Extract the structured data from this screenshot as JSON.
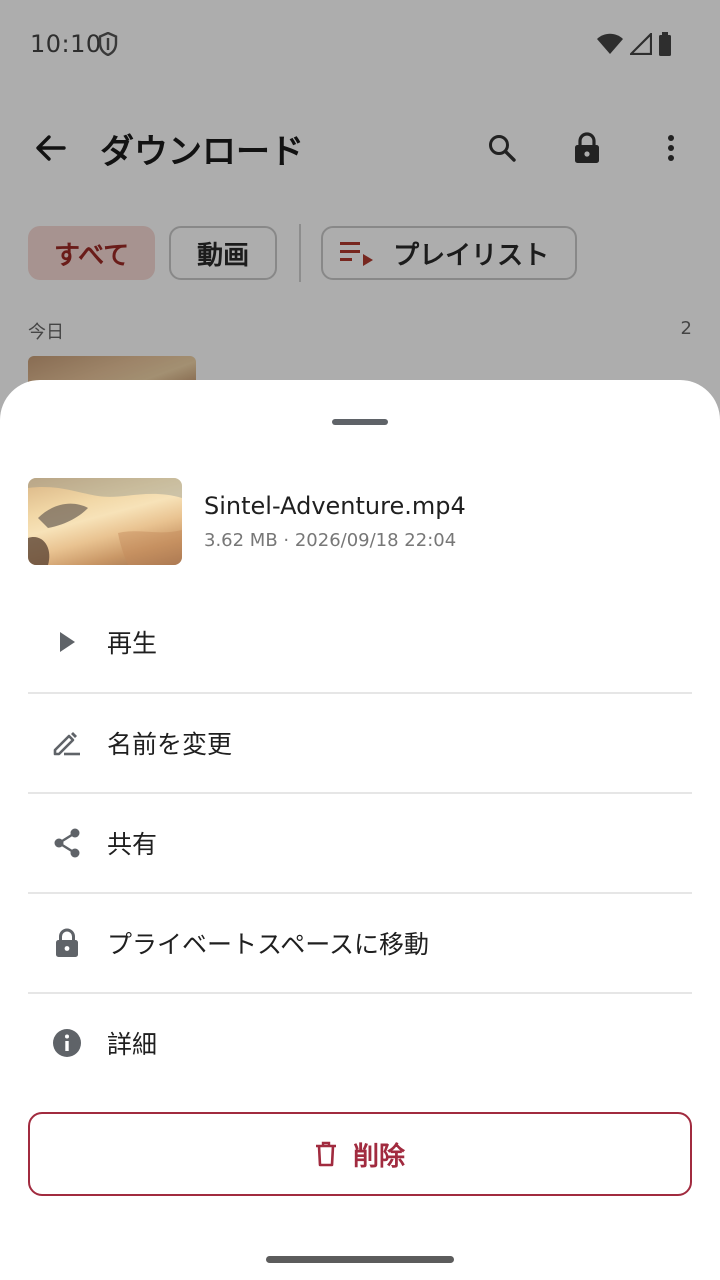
{
  "status_bar": {
    "time": "10:10",
    "icons": [
      "shield-icon",
      "wifi-icon",
      "signal-icon",
      "battery-icon"
    ]
  },
  "toolbar": {
    "title": "ダウンロード",
    "icons": [
      "back-arrow-icon",
      "search-icon",
      "lock-icon",
      "more-vert-icon"
    ]
  },
  "filters": {
    "all": "すべて",
    "video": "動画",
    "playlist": "プレイリスト",
    "selected": "すべて"
  },
  "section": {
    "label": "今日",
    "count": "2"
  },
  "sheet": {
    "file": {
      "name": "Sintel-Adventure.mp4",
      "meta": "3.62 MB · 2026/09/18 22:04"
    },
    "menu": [
      {
        "label": "再生",
        "icon": "play-icon"
      },
      {
        "label": "名前を変更",
        "icon": "edit-icon"
      },
      {
        "label": "共有",
        "icon": "share-icon"
      },
      {
        "label": "プライベートスペースに移動",
        "icon": "lock-icon"
      },
      {
        "label": "詳細",
        "icon": "info-icon"
      }
    ],
    "delete_label": "削除"
  },
  "colors": {
    "accent": "#a12b3f",
    "chip_selected_bg": "#f6d9d4",
    "chip_selected_text": "#9c2a26",
    "scrim": "rgba(0,0,0,0.32)"
  }
}
